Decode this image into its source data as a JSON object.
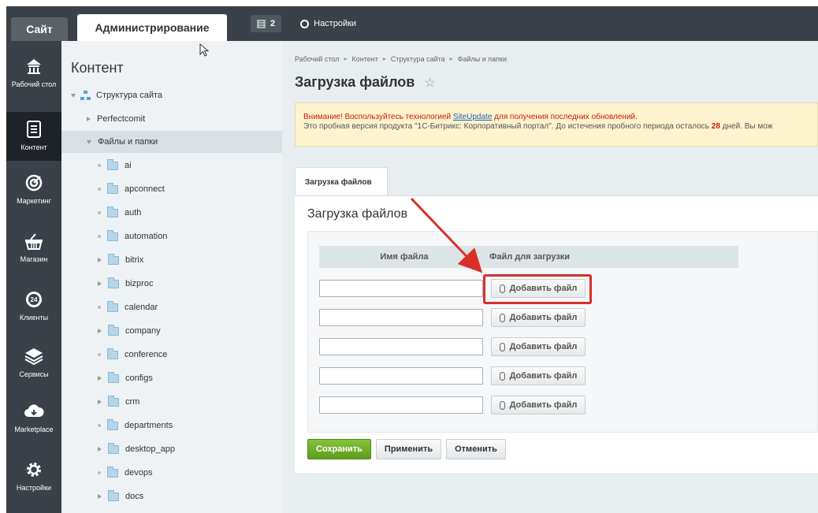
{
  "topbar": {
    "site_tab": "Сайт",
    "admin_tab": "Администрирование",
    "notifications_count": "2",
    "settings_label": "Настройки"
  },
  "leftbar": {
    "items": [
      {
        "label": "Рабочий стол",
        "icon": "home-icon"
      },
      {
        "label": "Контент",
        "icon": "document-icon"
      },
      {
        "label": "Маркетинг",
        "icon": "target-icon"
      },
      {
        "label": "Магазин",
        "icon": "basket-icon"
      },
      {
        "label": "Клиенты",
        "icon": "clients-24-icon"
      },
      {
        "label": "Сервисы",
        "icon": "layers-icon"
      },
      {
        "label": "Marketplace",
        "icon": "cloud-download-icon"
      },
      {
        "label": "Настройки",
        "icon": "gear-icon"
      }
    ]
  },
  "tree": {
    "title": "Контент",
    "root": "Структура сайта",
    "site": "Perfectcomit",
    "files": "Файлы и папки",
    "folders": [
      {
        "name": "ai",
        "expandable": false
      },
      {
        "name": "apconnect",
        "expandable": false
      },
      {
        "name": "auth",
        "expandable": false
      },
      {
        "name": "automation",
        "expandable": false
      },
      {
        "name": "bitrix",
        "expandable": true
      },
      {
        "name": "bizproc",
        "expandable": true
      },
      {
        "name": "calendar",
        "expandable": false
      },
      {
        "name": "company",
        "expandable": true
      },
      {
        "name": "conference",
        "expandable": false
      },
      {
        "name": "configs",
        "expandable": true
      },
      {
        "name": "crm",
        "expandable": true
      },
      {
        "name": "departments",
        "expandable": false
      },
      {
        "name": "desktop_app",
        "expandable": true
      },
      {
        "name": "devops",
        "expandable": false
      },
      {
        "name": "docs",
        "expandable": true
      }
    ]
  },
  "main": {
    "breadcrumb": [
      "Рабочий стол",
      "Контент",
      "Структура сайта",
      "Файлы и папки"
    ],
    "page_title": "Загрузка файлов",
    "warning": {
      "line1_pre": "Внимание! Воспользуйтесь технологией ",
      "line1_link": "SiteUpdate",
      "line1_post": " для получения последних обновлений.",
      "line2_pre": "Это пробная версия продукта \"1С-Битрикс: Корпоративный портал\". До истечения пробного периода осталось ",
      "days": "28",
      "line2_post": " дней. Вы мож"
    },
    "tab_label": "Загрузка файлов",
    "card_title": "Загрузка файлов",
    "col_name": "Имя файла",
    "col_file": "Файл для загрузки",
    "add_file_label": "Добавить файл",
    "rows": 5,
    "buttons": {
      "save": "Сохранить",
      "apply": "Применить",
      "cancel": "Отменить"
    }
  },
  "colors": {
    "dark_bar": "#3a4148",
    "save_green": "#6aac28",
    "highlight_red": "#d9302b",
    "warning_bg": "#fdf3ce"
  }
}
